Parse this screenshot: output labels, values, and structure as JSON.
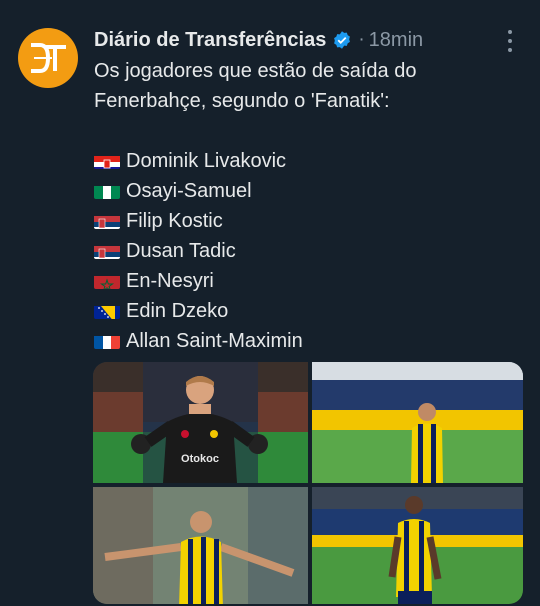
{
  "tweet": {
    "author_name": "Diário de Transferências",
    "verified": true,
    "separator": "·",
    "timestamp": "18min",
    "text_lines": [
      "Os jogadores que estão de saída do",
      "Fenerbahçe, segundo o 'Fanatik':"
    ],
    "players": [
      {
        "flag": "croatia-flag",
        "name": "Dominik Livakovic"
      },
      {
        "flag": "nigeria-flag",
        "name": "Osayi-Samuel"
      },
      {
        "flag": "serbia-flag",
        "name": "Filip Kostic"
      },
      {
        "flag": "serbia-flag",
        "name": "Dusan Tadic"
      },
      {
        "flag": "morocco-flag",
        "name": "En-Nesyri"
      },
      {
        "flag": "bosnia-flag",
        "name": "Edin Dzeko"
      },
      {
        "flag": "france-flag",
        "name": "Allan Saint-Maximin"
      }
    ],
    "media": [
      {
        "name": "goalkeeper-photo",
        "shirt_text": "Otokoc"
      },
      {
        "name": "player-stadium-photo-1"
      },
      {
        "name": "striker-celebration-photo"
      },
      {
        "name": "player-stadium-photo-2"
      }
    ]
  },
  "colors": {
    "background": "#15202b",
    "accent_avatar": "#f39c12",
    "verified_blue": "#1d9bf0",
    "secondary_text": "#8b98a5"
  }
}
